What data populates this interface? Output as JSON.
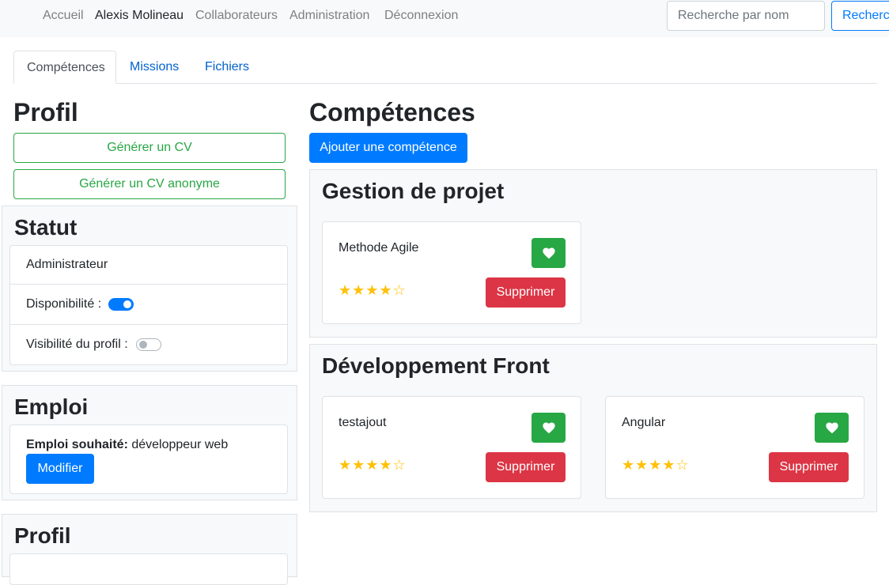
{
  "nav": {
    "items": [
      "Accueil",
      "Alexis Molineau",
      "Collaborateurs",
      "Administration",
      "Déconnexion"
    ],
    "search_placeholder": "Recherche par nom",
    "search_button": "Rechercher"
  },
  "tabs": [
    "Compétences",
    "Missions",
    "Fichiers"
  ],
  "left": {
    "profil_title": "Profil",
    "generate_cv": "Générer un CV",
    "generate_cv_anon": "Générer un CV anonyme",
    "statut": {
      "title": "Statut",
      "role": "Administrateur",
      "availability_label": "Disponibilité :",
      "availability_on": true,
      "visibility_label": "Visibilité du profil :",
      "visibility_on": false
    },
    "emploi": {
      "title": "Emploi",
      "label": "Emploi souhaité:",
      "value": "développeur web",
      "modify": "Modifier"
    },
    "profil2_title": "Profil"
  },
  "main": {
    "title": "Compétences",
    "add_button": "Ajouter une compétence",
    "categories": [
      {
        "name": "Gestion de projet",
        "skills": [
          {
            "name": "Methode Agile",
            "rating": 4,
            "max": 5,
            "delete": "Supprimer"
          }
        ]
      },
      {
        "name": "Développement Front",
        "skills": [
          {
            "name": "testajout",
            "rating": 4,
            "max": 5,
            "delete": "Supprimer"
          },
          {
            "name": "Angular",
            "rating": 4,
            "max": 5,
            "delete": "Supprimer"
          }
        ]
      }
    ]
  },
  "colors": {
    "primary": "#007bff",
    "success": "#28a745",
    "danger": "#dc3545",
    "star": "#ffc107"
  },
  "icons": {
    "heart": "heart-icon",
    "star_full": "★",
    "star_empty": "☆"
  }
}
